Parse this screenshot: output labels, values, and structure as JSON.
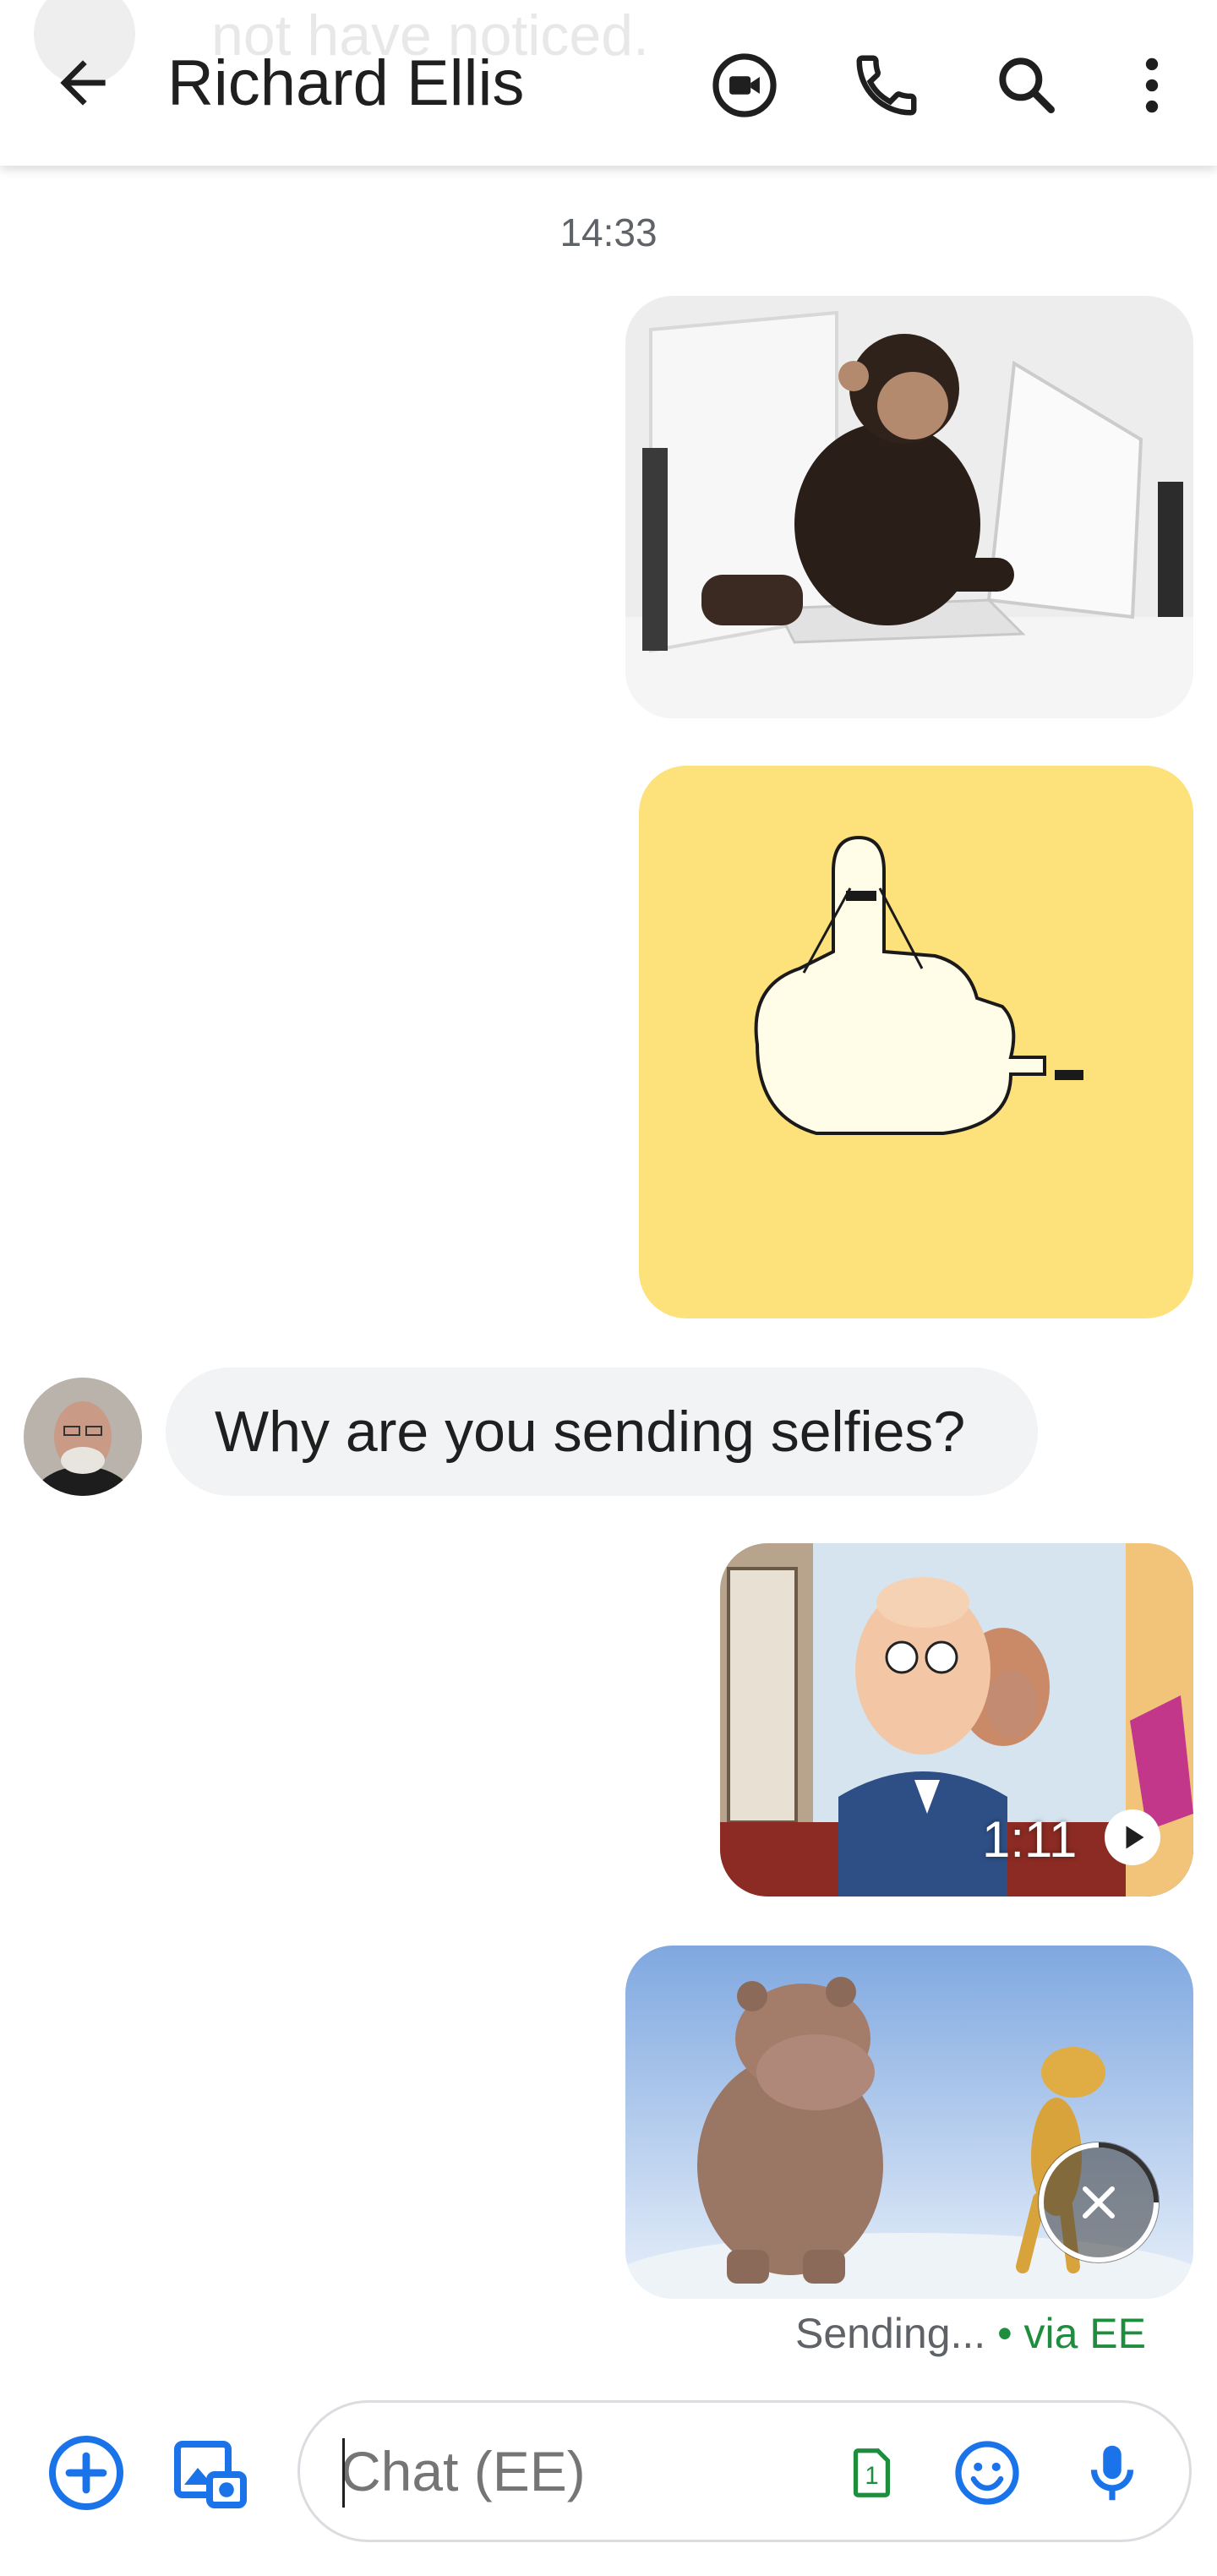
{
  "header": {
    "ghost_text": "not have noticed.",
    "title": "Richard Ellis",
    "icons": [
      "back-arrow-icon",
      "video-call-icon",
      "phone-icon",
      "search-icon",
      "more-vert-icon"
    ]
  },
  "conversation": {
    "timestamp": "14:33",
    "received_message": "Why are you sending selfies?",
    "video": {
      "duration": "1:11"
    },
    "status": {
      "sending": "Sending...",
      "separator": " • ",
      "carrier": "via EE"
    }
  },
  "compose": {
    "placeholder": "Chat (EE)",
    "sim_label": "1",
    "icons": [
      "add-circle-icon",
      "gallery-icon",
      "sim-icon",
      "emoji-icon",
      "mic-icon"
    ]
  },
  "colors": {
    "accent_blue": "#1a73e8",
    "green": "#1e8e3e",
    "received_bubble": "#f1f3f4",
    "sticker_background": "#fde17a"
  }
}
